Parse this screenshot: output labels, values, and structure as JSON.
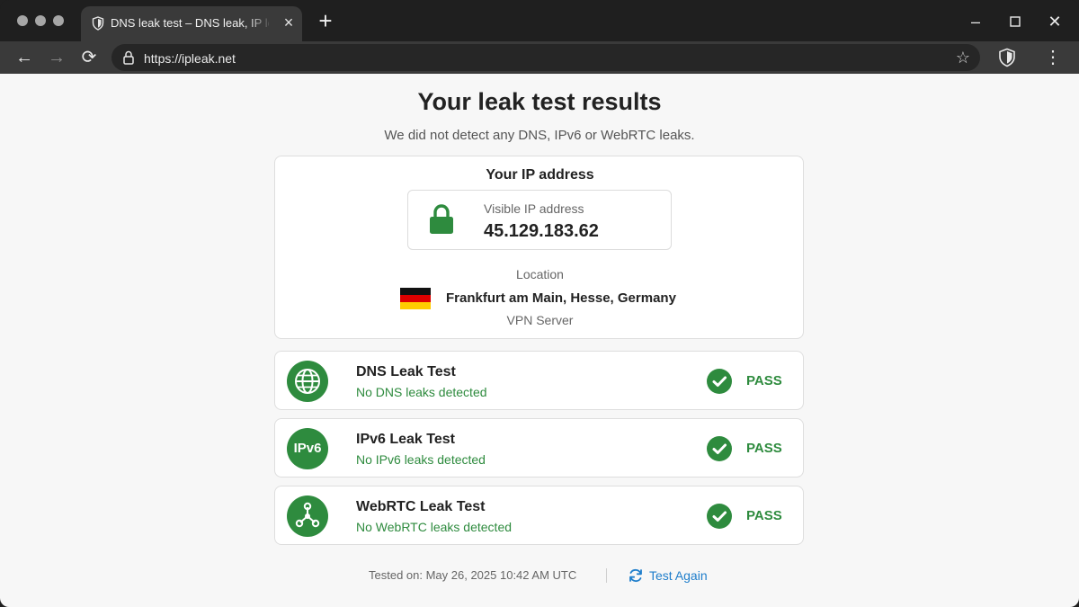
{
  "browser": {
    "tab_title": "DNS leak test – DNS leak, IP leak",
    "url": "https://ipleak.net",
    "icons": [
      "shield-icon",
      "close-icon",
      "plus-icon",
      "minimize-icon",
      "maximize-icon",
      "close-window-icon",
      "back-icon",
      "forward-icon",
      "reload-icon",
      "lock-icon",
      "star-icon",
      "extension-shield-icon",
      "more-menu-icon"
    ]
  },
  "header": {
    "title": "Your leak test results",
    "subtitle": "We did not detect any DNS, IPv6 or WebRTC leaks."
  },
  "ip_card": {
    "title": "Your IP address",
    "visible_label": "Visible IP address",
    "ip": "45.129.183.62",
    "location_label": "Location",
    "location": "Frankfurt am Main, Hesse, Germany",
    "location_note": "VPN Server"
  },
  "tests": [
    {
      "title": "DNS Leak Test",
      "subtitle": "No DNS leaks detected",
      "status": "PASS",
      "icon": "globe-icon"
    },
    {
      "title": "IPv6 Leak Test",
      "subtitle": "No IPv6 leaks detected",
      "status": "PASS",
      "icon": "ipv6-icon",
      "icon_text": "IPv6"
    },
    {
      "title": "WebRTC Leak Test",
      "subtitle": "No WebRTC leaks detected",
      "status": "PASS",
      "icon": "network-icon"
    }
  ],
  "footer": {
    "tested_on": "Tested on: May 26, 2025 10:42 AM UTC",
    "test_again": "Test Again"
  },
  "colors": {
    "pass_green": "#2e8b3e",
    "link_blue": "#1f7ecb",
    "browser_dark": "#1f1f1f"
  }
}
